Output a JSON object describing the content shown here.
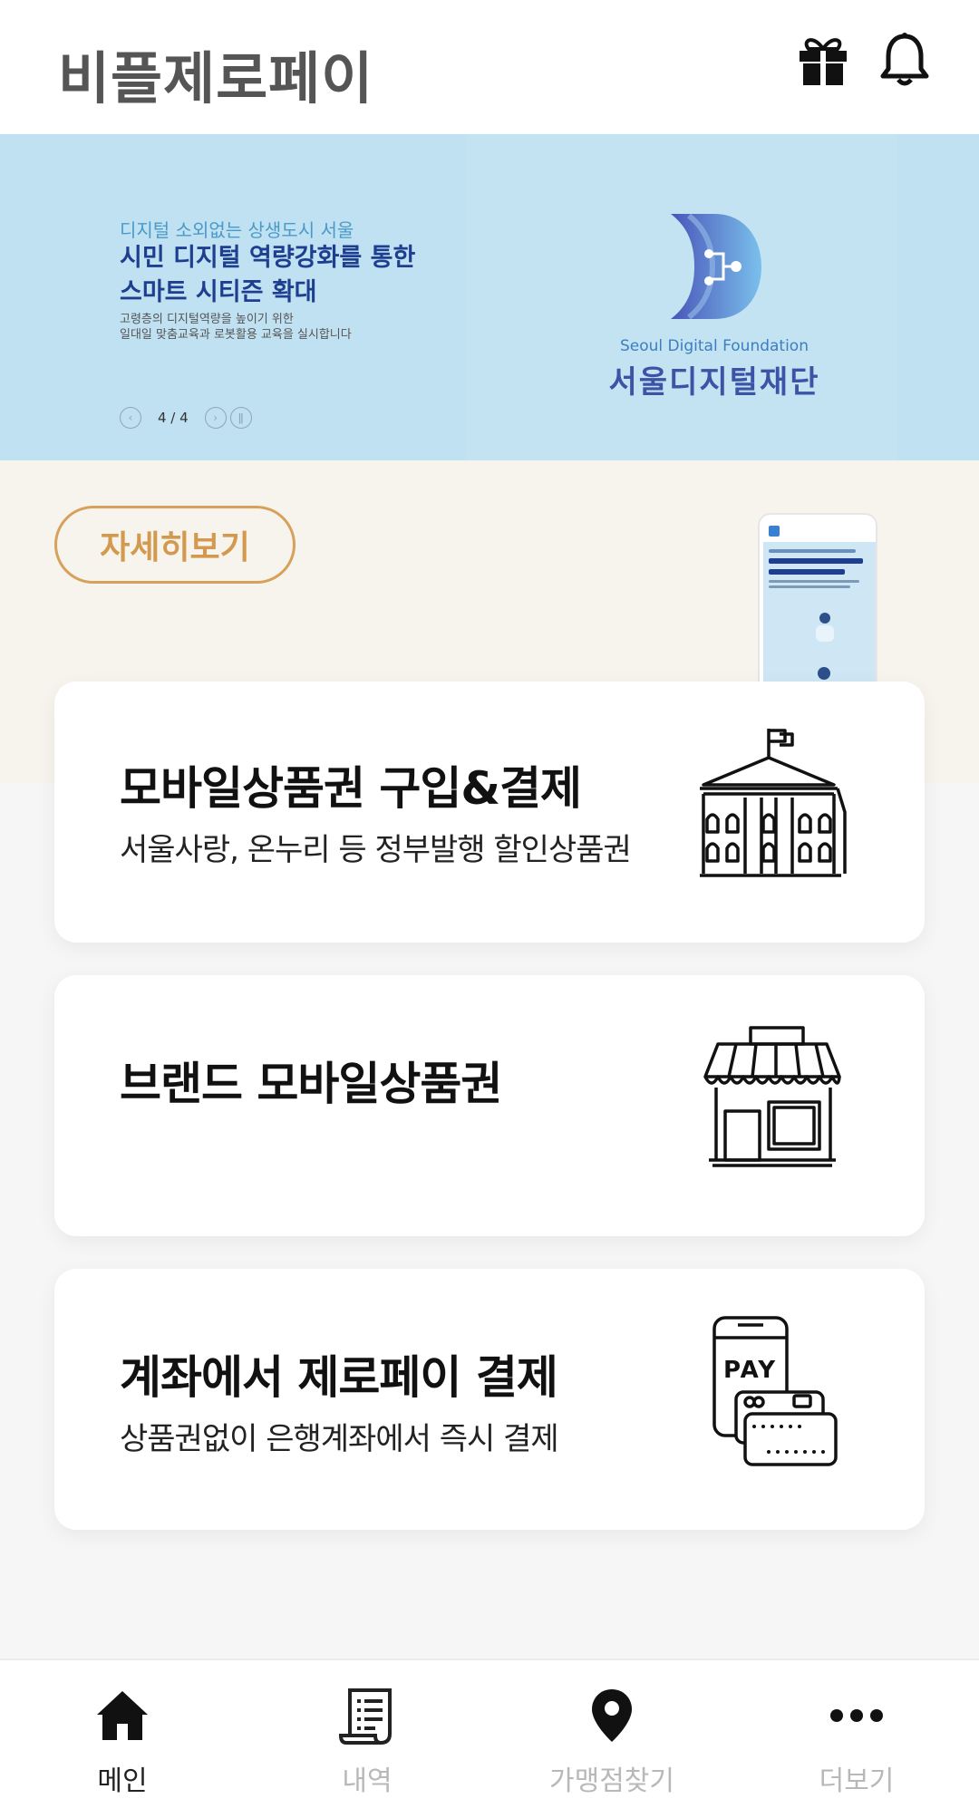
{
  "header": {
    "title": "비플제로페이",
    "icons": [
      "gift-icon",
      "bell-icon"
    ]
  },
  "banner": {
    "subtitle": "디지털 소외없는 상생도시 서울",
    "headline": [
      "시민 디지털 역량강화를 통한",
      "스마트 시티즌 확대"
    ],
    "description": [
      "고령층의 디지털역량을 높이기 위한",
      "일대일 맞춤교육과 로봇활용 교육을 실시합니다"
    ],
    "pager": "4 / 4",
    "logo_en": "Seoul Digital Foundation",
    "logo_ko": "서울디지털재단",
    "detail_button": "자세히보기",
    "colors": {
      "sky": "#c0e1f1",
      "cream": "#f6f4ec",
      "accent": "#d7a15c"
    }
  },
  "cards": [
    {
      "title": "모바일상품권 구입&결제",
      "subtitle": "서울사랑, 온누리 등 정부발행 할인상품권",
      "icon": "government-building-icon"
    },
    {
      "title": "브랜드 모바일상품권",
      "subtitle": "",
      "icon": "store-icon"
    },
    {
      "title": "계좌에서 제로페이 결제",
      "subtitle": "상품권없이 은행계좌에서 즉시 결제",
      "icon": "mobile-pay-card-icon",
      "icon_text": "PAY"
    }
  ],
  "tabs": [
    {
      "label": "메인",
      "icon": "home-icon",
      "active": true
    },
    {
      "label": "내역",
      "icon": "receipt-icon",
      "active": false
    },
    {
      "label": "가맹점찾기",
      "icon": "location-pin-icon",
      "active": false
    },
    {
      "label": "더보기",
      "icon": "more-dots-icon",
      "active": false
    }
  ]
}
